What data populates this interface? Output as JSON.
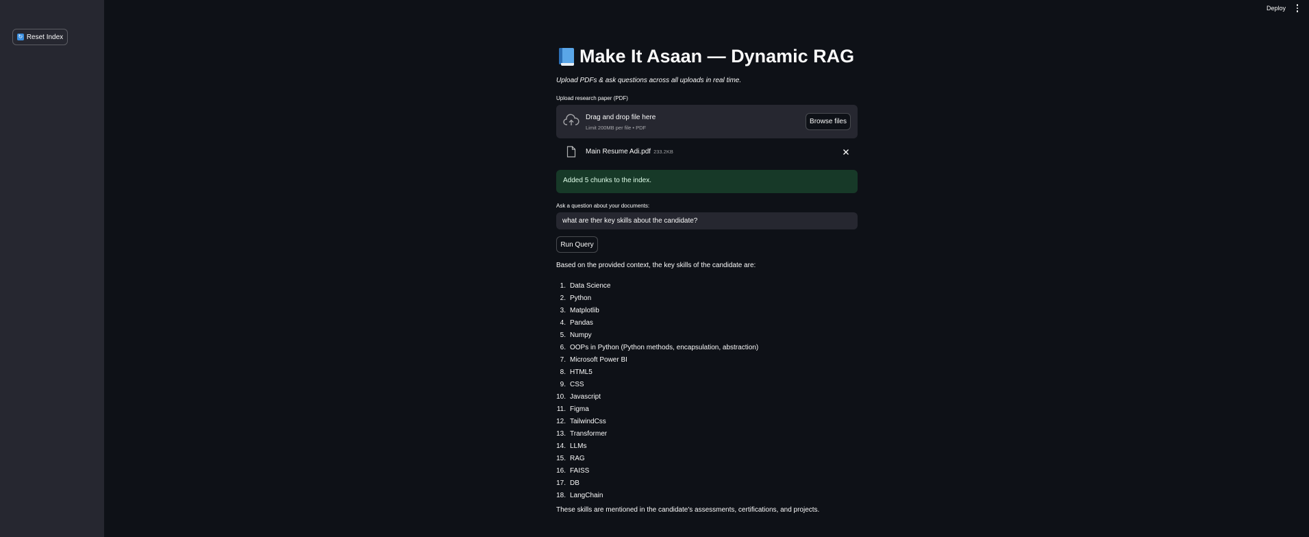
{
  "sidebar": {
    "reset_label": "Reset Index",
    "reset_icon": "refresh-icon"
  },
  "topbar": {
    "deploy_label": "Deploy",
    "menu_icon": "kebab-menu-icon"
  },
  "main": {
    "title": "Make It Asaan — Dynamic RAG",
    "title_icon": "blue-book-icon",
    "subtitle": "Upload PDFs & ask questions across all uploads in real time.",
    "upload": {
      "label": "Upload research paper (PDF)",
      "drop_text": "Drag and drop file here",
      "limit_text": "Limit 200MB per file • PDF",
      "browse_label": "Browse files"
    },
    "file": {
      "name": "Main Resume Adi.pdf",
      "size": "233.2KB"
    },
    "success_message": "Added 5 chunks to the index.",
    "question": {
      "label": "Ask a question about your documents:",
      "value": "what are ther key skills about the candidate?"
    },
    "run_label": "Run Query",
    "answer": {
      "intro": "Based on the provided context, the key skills of the candidate are:",
      "skills": [
        "Data Science",
        "Python",
        "Matplotlib",
        "Pandas",
        "Numpy",
        "OOPs in Python (Python methods, encapsulation, abstraction)",
        "Microsoft Power BI",
        "HTML5",
        "CSS",
        "Javascript",
        "Figma",
        "TailwindCss",
        "Transformer",
        "LLMs",
        "RAG",
        "FAISS",
        "DB",
        "LangChain"
      ],
      "outro": "These skills are mentioned in the candidate's assessments, certifications, and projects."
    }
  },
  "colors": {
    "background": "#0e1117",
    "sidebar": "#262730",
    "success_bg": "#173928",
    "accent_blue": "#3b8fe0"
  }
}
